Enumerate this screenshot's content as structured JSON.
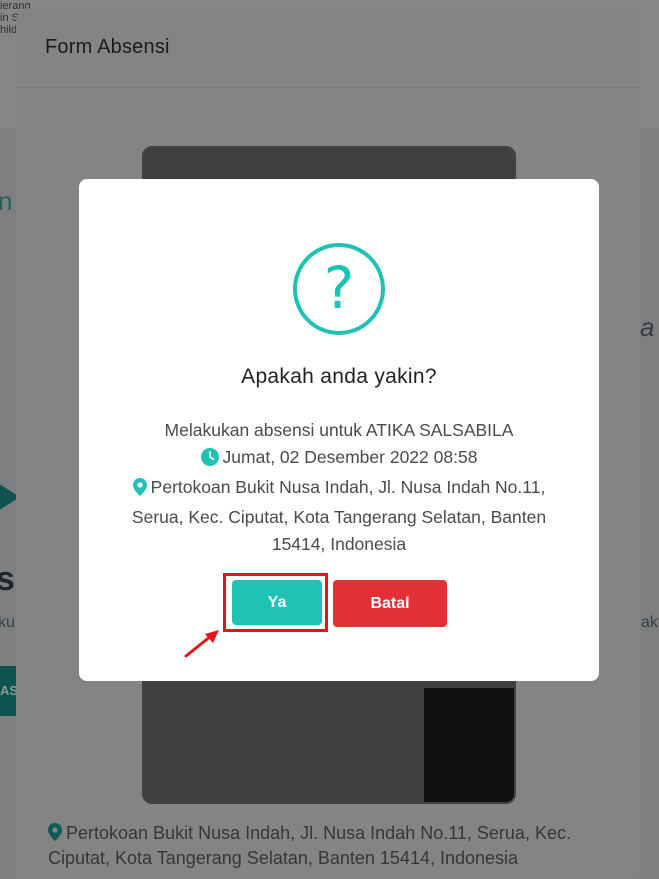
{
  "background": {
    "left_text_lines": [
      "ierang",
      "in S",
      "hild"
    ],
    "left_fragments": [
      {
        "text": "n"
      },
      {
        "text": "si"
      },
      {
        "text": "ku"
      },
      {
        "text": "AS"
      }
    ],
    "right_fragments": [
      {
        "text": "a"
      },
      {
        "text": "aki"
      }
    ]
  },
  "form": {
    "title": "Form Absensi",
    "address": "Pertokoan Bukit Nusa Indah, Jl. Nusa Indah No.11, Serua, Kec. Ciputat, Kota Tangerang Selatan, Banten 15414, Indonesia"
  },
  "dialog": {
    "icon_glyph": "?",
    "title": "Apakah anda yakin?",
    "message": "Melakukan absensi untuk ATIKA SALSABILA",
    "datetime": "Jumat, 02 Desember 2022 08:58",
    "location": "Pertokoan Bukit Nusa Indah, Jl. Nusa Indah No.11, Serua, Kec. Ciputat, Kota Tangerang Selatan, Banten 15414, Indonesia",
    "confirm_label": "Ya",
    "cancel_label": "Batal"
  },
  "colors": {
    "accent": "#20c2b6",
    "danger": "#e23134",
    "highlight": "#e3141c"
  },
  "icons": {
    "question": "question-mark-circle-icon",
    "clock": "clock-icon",
    "pin": "map-pin-icon",
    "arrow": "red-arrow-icon"
  }
}
